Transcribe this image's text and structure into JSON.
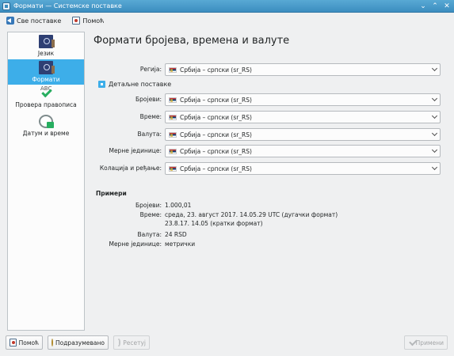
{
  "window": {
    "title": "Формати — Системске поставке"
  },
  "toolbar": {
    "overview_label": "Све поставке",
    "help_label": "Помоћ"
  },
  "sidebar": {
    "items": [
      {
        "label": "Језик",
        "icon": "language-flag-icon",
        "active": false
      },
      {
        "label": "Формати",
        "icon": "formats-flag-icon",
        "active": true
      },
      {
        "label": "Провера правописа",
        "icon": "spellcheck-icon",
        "active": false
      },
      {
        "label": "Датум и време",
        "icon": "clock-icon",
        "active": false
      }
    ]
  },
  "main": {
    "title": "Формати бројева, времена и валуте",
    "region": {
      "label": "Регија:",
      "value": "Србија – српски (sr_RS)"
    },
    "detailed_settings": {
      "label": "Детаљне поставке",
      "checked": true
    },
    "settings": [
      {
        "label": "Бројеви:",
        "value": "Србија – српски (sr_RS)"
      },
      {
        "label": "Време:",
        "value": "Србија – српски (sr_RS)"
      },
      {
        "label": "Валута:",
        "value": "Србија – српски (sr_RS)"
      },
      {
        "label": "Мерне јединице:",
        "value": "Србија – српски (sr_RS)"
      },
      {
        "label": "Колација и ређање:",
        "value": "Србија – српски (sr_RS)"
      }
    ],
    "examples": {
      "title": "Примери",
      "numbers_label": "Бројеви:",
      "numbers_value": "1.000,01",
      "time_label": "Време:",
      "time_long": "среда, 23. август 2017. 14.05.29 UTC (дугачки формат)",
      "time_short": "23.8.17. 14.05 (кратки формат)",
      "currency_label": "Валута:",
      "currency_value": "24 RSD",
      "units_label": "Мерне јединице:",
      "units_value": "метрички"
    }
  },
  "footer": {
    "help_label": "Помоћ",
    "defaults_label": "Подразумевано",
    "reset_label": "Ресетуј",
    "apply_label": "Примени"
  },
  "colors": {
    "accent": "#3daee9",
    "titlebar": "#4a9bcb",
    "background": "#eff0f1"
  }
}
